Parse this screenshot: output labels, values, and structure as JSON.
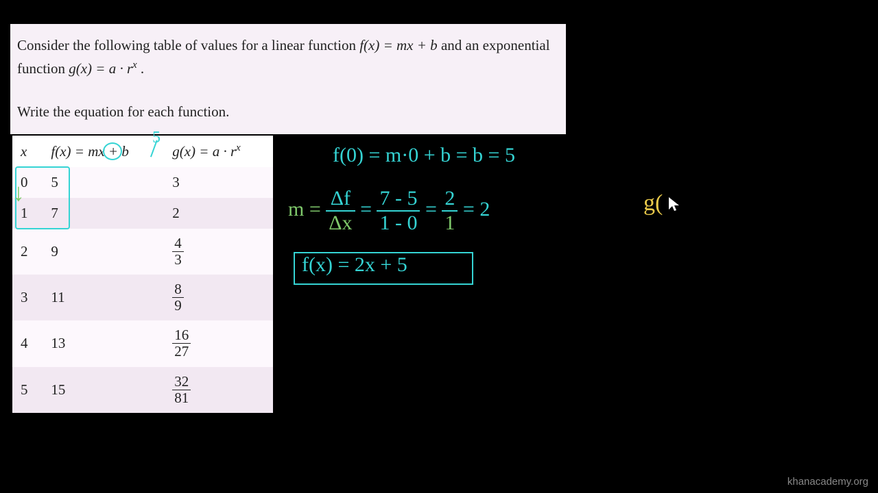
{
  "problem": {
    "line1_pre": "Consider the following table of values for a linear function ",
    "line1_f": "f(x) = mx + b",
    "line1_mid": " and an exponential function ",
    "line1_g": "g(x) = a · r",
    "line1_gexp": "x",
    "line1_post": " .",
    "line2": "Write the equation for each function."
  },
  "table": {
    "h1": "x",
    "h2_f": "f(x) = ",
    "h2_m": "m",
    "h2_mid": "x + ",
    "h2_b": "b",
    "h3_g": "g(x) = a · r",
    "h3_exp": "x",
    "rows": [
      {
        "x": "0",
        "f": "5",
        "g": "3"
      },
      {
        "x": "1",
        "f": "7",
        "g": "2"
      },
      {
        "x": "2",
        "f": "9",
        "g_num": "4",
        "g_den": "3"
      },
      {
        "x": "3",
        "f": "11",
        "g_num": "8",
        "g_den": "9"
      },
      {
        "x": "4",
        "f": "13",
        "g_num": "16",
        "g_den": "27"
      },
      {
        "x": "5",
        "f": "15",
        "g_num": "32",
        "g_den": "81"
      }
    ]
  },
  "annot": {
    "five": "5",
    "arrow": "↓",
    "work1": "f(0) = m·0 + b  = b = 5",
    "work2_m": "m = ",
    "work2_df": "Δf",
    "work2_dx": "Δx",
    "work2_eq1": " = ",
    "work2_n1": "7 - 5",
    "work2_d1": "1 - 0",
    "work2_eq2": " = ",
    "work2_n2": "2",
    "work2_d2": "1",
    "work2_eq3": " = 2",
    "work3": "f(x) = 2x + 5",
    "gwork": "g("
  },
  "watermark": "khanacademy.org"
}
